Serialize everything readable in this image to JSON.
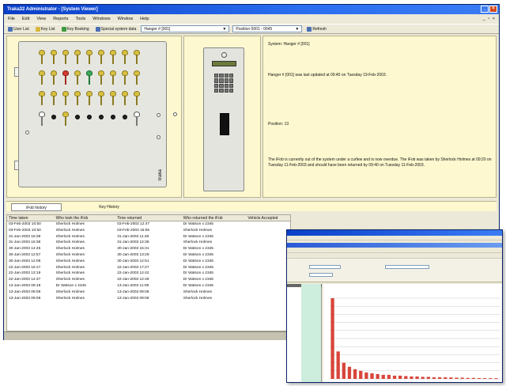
{
  "window": {
    "title": "Traka32 Administrator - [System Viewer]",
    "doc_controls": "_ ▫ ×"
  },
  "menu": [
    "File",
    "Edit",
    "View",
    "Reports",
    "Tools",
    "Windows",
    "Window",
    "Help"
  ],
  "toolbar": {
    "user_list": "User List",
    "key_list": "Key List",
    "key_booking": "Key Booking",
    "special_system_data": "Special system data",
    "hanger_select": "Hanger # [001]",
    "position_select": "Position 0001 - 0045",
    "refresh": "Refresh"
  },
  "info": {
    "heading": "System: Hanger # [001]",
    "updated": "Hanger # [001] was last updated at 09:40 on Tuesday 19-Feb-2003.",
    "position": "Position: 13",
    "status": "The iFob is currently out of the system under a curfew and is now overdue. The iFob was taken by Sherlock Holmes at 09:20 on Tuesday 11-Feb-2003 and should have been returned by 09:40 on Tuesday 11-Feb-2003."
  },
  "tabs": [
    "iFob history",
    "Key History"
  ],
  "cabinet": {
    "brand": "traka",
    "keys": [
      "key",
      "key",
      "key",
      "key",
      "key",
      "key",
      "key",
      "key",
      "key",
      "key",
      "key",
      "red",
      "key",
      "green",
      "key",
      "key",
      "key",
      "key",
      "key",
      "key",
      "key",
      "key",
      "key",
      "key",
      "key",
      "key",
      "key",
      "out",
      "empty",
      "key",
      "empty",
      "empty",
      "empty",
      "empty",
      "empty",
      "out"
    ]
  },
  "history": {
    "columns": [
      "Time taken",
      "Who took the iFob",
      "Time returned",
      "Who returned the iFob",
      "Vehicle Accepted"
    ],
    "rows": [
      [
        "03-Feb-2003 10:50",
        "Sherlock Holmes",
        "03-Feb-2003 12:47",
        "Dr Watson x 2345",
        ""
      ],
      [
        "03-Feb-2003 10:50",
        "Sherlock Holmes",
        "03-Feb-2003 15:55",
        "Sherlock Holmes",
        ""
      ],
      [
        "31-Jan-2003 16:38",
        "Sherlock Holmes",
        "31-Jan-2003 11:48",
        "Dr Watson x 2345",
        ""
      ],
      [
        "31-Jan-2003 16:38",
        "Sherlock Holmes",
        "31-Jan-2003 12:36",
        "Sherlock Holmes",
        ""
      ],
      [
        "30-Jan-2003 14:45",
        "Sherlock Holmes",
        "30-Jan-2003 15:31",
        "Dr Watson x 2345",
        ""
      ],
      [
        "30-Jan-2003 12:57",
        "Sherlock Holmes",
        "30-Jan-2003 13:29",
        "Dr Watson x 2345",
        ""
      ],
      [
        "30-Jan-2003 12:08",
        "Sherlock Holmes",
        "30-Jan-2003 12:51",
        "Dr Watson x 2345",
        ""
      ],
      [
        "22-Jan-2003 16:17",
        "Sherlock Holmes",
        "22-Jan-2003 17:27",
        "Dr Watson x 2345",
        ""
      ],
      [
        "22-Jan-2003 13:19",
        "Sherlock Holmes",
        "22-Jan-2003 14:42",
        "Dr Watson x 2345",
        ""
      ],
      [
        "22-Jan-2003 14:37",
        "Sherlock Holmes",
        "22-Jan-2003 12:48",
        "Dr Watson x 2345",
        ""
      ],
      [
        "13-Jan-2003 09:18",
        "Dr Watson x 2345",
        "13-Jan-2003 11:08",
        "Dr Watson x 2345",
        ""
      ],
      [
        "13-Jan-2003 09:08",
        "Sherlock Holmes",
        "13-Jan-2003 09:08",
        "Sherlock Holmes",
        ""
      ],
      [
        "13-Jan-2003 09:08",
        "Sherlock Holmes",
        "13-Jan-2003 09:08",
        "Sherlock Holmes",
        ""
      ]
    ]
  },
  "overlay_chart": {
    "bar_fraction": [
      1.0,
      0.34,
      0.2,
      0.15,
      0.12,
      0.1,
      0.08,
      0.07,
      0.06,
      0.05,
      0.05,
      0.04,
      0.04,
      0.035,
      0.03,
      0.03,
      0.025,
      0.025,
      0.02,
      0.02,
      0.02,
      0.018,
      0.015,
      0.015,
      0.012,
      0.012,
      0.01,
      0.01,
      0.01,
      0.008
    ],
    "bar_color": "#d9453a"
  },
  "colors": {
    "accent": "#0a3fc8",
    "panel": "#fdf8cf"
  }
}
